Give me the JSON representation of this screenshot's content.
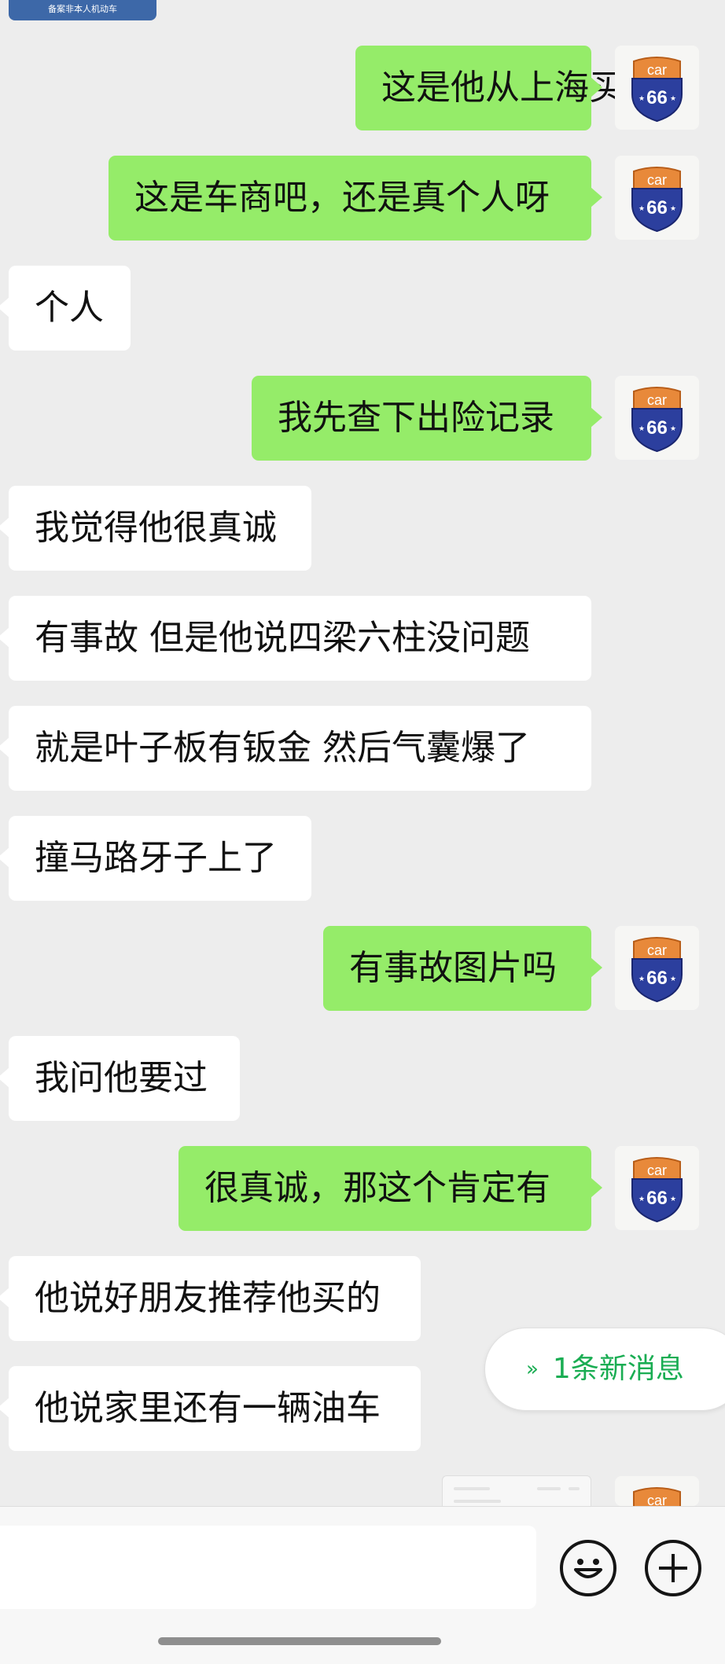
{
  "top_card": {
    "text": "备案非本人机动车"
  },
  "avatar": {
    "top_text": "car",
    "number": "66"
  },
  "messages": [
    {
      "side": "right",
      "text": "这是他从上海买的"
    },
    {
      "side": "right",
      "text": "这是车商吧，还是真个人呀"
    },
    {
      "side": "left",
      "text": "个人"
    },
    {
      "side": "right",
      "text": "我先查下出险记录"
    },
    {
      "side": "left",
      "text": "我觉得他很真诚"
    },
    {
      "side": "left",
      "text": "有事故 但是他说四梁六柱没问题"
    },
    {
      "side": "left",
      "text": "就是叶子板有钣金 然后气囊爆了"
    },
    {
      "side": "left",
      "text": "撞马路牙子上了"
    },
    {
      "side": "right",
      "text": "有事故图片吗"
    },
    {
      "side": "left",
      "text": "我问他要过"
    },
    {
      "side": "right",
      "text": "很真诚，那这个肯定有"
    },
    {
      "side": "left",
      "text": "他说好朋友推荐他买的"
    },
    {
      "side": "left",
      "text": "他说家里还有一辆油车"
    }
  ],
  "new_message": {
    "chevron": "»",
    "label": "1条新消息"
  },
  "input": {
    "value": "",
    "placeholder": ""
  },
  "icons": {
    "emoji": "emoji-icon",
    "plus": "plus-icon"
  },
  "colors": {
    "sent_bubble": "#95ec69",
    "received_bubble": "#ffffff",
    "accent": "#1aad53",
    "background": "#ededed"
  }
}
